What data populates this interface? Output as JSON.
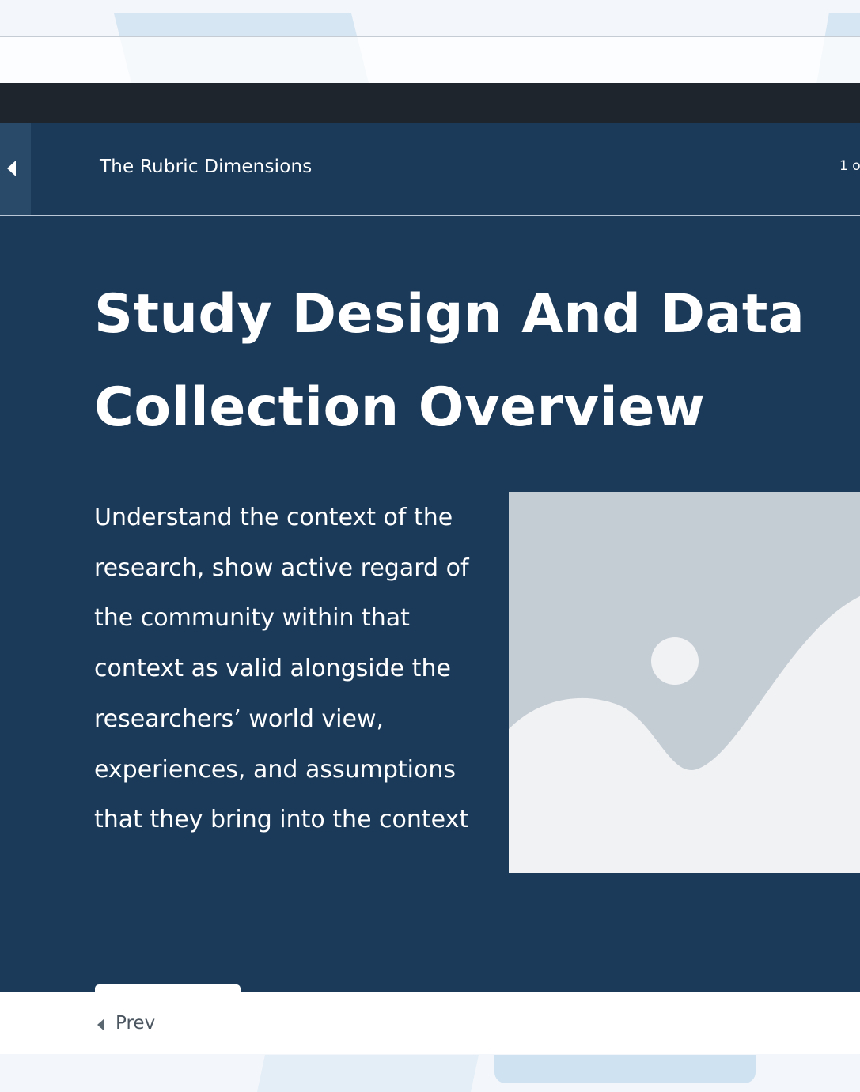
{
  "header": {
    "back_icon": "caret-left-icon",
    "title": "The Rubric Dimensions",
    "page_count": "1 of"
  },
  "main": {
    "title": "Study Design And Data Collection Overview",
    "description": "Understand the context of the research, show active regard of the community within that context as valid alongside the researchers’ world view, experiences, and assumptions that they bring into the context",
    "image_icon": "image-placeholder-icon"
  },
  "footer": {
    "prev_icon": "caret-left-icon",
    "prev_label": "Prev"
  },
  "colors": {
    "header_bg": "#1b3a59",
    "content_bg": "#1b3a59",
    "dark_bar": "#1e252c",
    "placeholder_bg": "#c4ccd4",
    "placeholder_fg": "#f1f2f4"
  }
}
